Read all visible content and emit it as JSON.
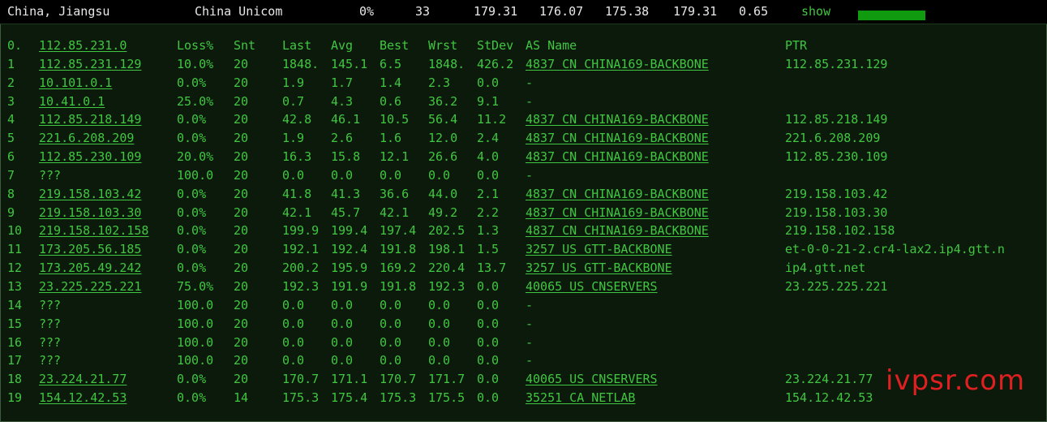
{
  "status": {
    "location": "China, Jiangsu",
    "isp": "China Unicom",
    "loss": "0%",
    "sent": "33",
    "last": "179.31",
    "avg": "176.07",
    "best": "175.38",
    "worst": "179.31",
    "stdev": "0.65",
    "show_label": "show",
    "progress": 1.0,
    "bar_color": "#0f9a0f"
  },
  "headers": {
    "hop": "0.",
    "host": "112.85.231.0",
    "loss": "Loss%",
    "snt": "Snt",
    "last": "Last",
    "avg": "Avg",
    "best": "Best",
    "wrst": "Wrst",
    "stdev": "StDev",
    "asname": "AS Name",
    "ptr": "PTR"
  },
  "hops": [
    {
      "hop": "1",
      "host": "112.85.231.129",
      "loss": "10.0%",
      "snt": "20",
      "last": "1848.",
      "avg": "145.1",
      "best": "6.5",
      "wrst": "1848.",
      "stdev": "426.2",
      "as": "4837  CN CHINA169-BACKBONE",
      "ptr": "112.85.231.129"
    },
    {
      "hop": "2",
      "host": "10.101.0.1",
      "loss": "0.0%",
      "snt": "20",
      "last": "1.9",
      "avg": "1.7",
      "best": "1.4",
      "wrst": "2.3",
      "stdev": "0.0",
      "as": "-",
      "ptr": ""
    },
    {
      "hop": "3",
      "host": "10.41.0.1",
      "loss": "25.0%",
      "snt": "20",
      "last": "0.7",
      "avg": "4.3",
      "best": "0.6",
      "wrst": "36.2",
      "stdev": "9.1",
      "as": "-",
      "ptr": ""
    },
    {
      "hop": "4",
      "host": "112.85.218.149",
      "loss": "0.0%",
      "snt": "20",
      "last": "42.8",
      "avg": "46.1",
      "best": "10.5",
      "wrst": "56.4",
      "stdev": "11.2",
      "as": "4837  CN CHINA169-BACKBONE",
      "ptr": "112.85.218.149"
    },
    {
      "hop": "5",
      "host": "221.6.208.209",
      "loss": "0.0%",
      "snt": "20",
      "last": "1.9",
      "avg": "2.6",
      "best": "1.6",
      "wrst": "12.0",
      "stdev": "2.4",
      "as": "4837  CN CHINA169-BACKBONE",
      "ptr": "221.6.208.209"
    },
    {
      "hop": "6",
      "host": "112.85.230.109",
      "loss": "20.0%",
      "snt": "20",
      "last": "16.3",
      "avg": "15.8",
      "best": "12.1",
      "wrst": "26.6",
      "stdev": "4.0",
      "as": "4837  CN CHINA169-BACKBONE",
      "ptr": "112.85.230.109"
    },
    {
      "hop": "7",
      "host": "???",
      "loss": "100.0",
      "snt": "20",
      "last": "0.0",
      "avg": "0.0",
      "best": "0.0",
      "wrst": "0.0",
      "stdev": "0.0",
      "as": "-",
      "ptr": ""
    },
    {
      "hop": "8",
      "host": "219.158.103.42",
      "loss": "0.0%",
      "snt": "20",
      "last": "41.8",
      "avg": "41.3",
      "best": "36.6",
      "wrst": "44.0",
      "stdev": "2.1",
      "as": "4837  CN CHINA169-BACKBONE",
      "ptr": "219.158.103.42"
    },
    {
      "hop": "9",
      "host": "219.158.103.30",
      "loss": "0.0%",
      "snt": "20",
      "last": "42.1",
      "avg": "45.7",
      "best": "42.1",
      "wrst": "49.2",
      "stdev": "2.2",
      "as": "4837  CN CHINA169-BACKBONE",
      "ptr": "219.158.103.30"
    },
    {
      "hop": "10",
      "host": "219.158.102.158",
      "loss": "0.0%",
      "snt": "20",
      "last": "199.9",
      "avg": "199.4",
      "best": "197.4",
      "wrst": "202.5",
      "stdev": "1.3",
      "as": "4837  CN CHINA169-BACKBONE",
      "ptr": "219.158.102.158"
    },
    {
      "hop": "11",
      "host": "173.205.56.185",
      "loss": "0.0%",
      "snt": "20",
      "last": "192.1",
      "avg": "192.4",
      "best": "191.8",
      "wrst": "198.1",
      "stdev": "1.5",
      "as": "3257  US GTT-BACKBONE",
      "ptr": "et-0-0-21-2.cr4-lax2.ip4.gtt.n"
    },
    {
      "hop": "12",
      "host": "173.205.49.242",
      "loss": "0.0%",
      "snt": "20",
      "last": "200.2",
      "avg": "195.9",
      "best": "169.2",
      "wrst": "220.4",
      "stdev": "13.7",
      "as": "3257  US GTT-BACKBONE",
      "ptr": "ip4.gtt.net"
    },
    {
      "hop": "13",
      "host": "23.225.225.221",
      "loss": "75.0%",
      "snt": "20",
      "last": "192.3",
      "avg": "191.9",
      "best": "191.8",
      "wrst": "192.3",
      "stdev": "0.0",
      "as": "40065 US CNSERVERS",
      "ptr": "23.225.225.221"
    },
    {
      "hop": "14",
      "host": "???",
      "loss": "100.0",
      "snt": "20",
      "last": "0.0",
      "avg": "0.0",
      "best": "0.0",
      "wrst": "0.0",
      "stdev": "0.0",
      "as": "-",
      "ptr": ""
    },
    {
      "hop": "15",
      "host": "???",
      "loss": "100.0",
      "snt": "20",
      "last": "0.0",
      "avg": "0.0",
      "best": "0.0",
      "wrst": "0.0",
      "stdev": "0.0",
      "as": "-",
      "ptr": ""
    },
    {
      "hop": "16",
      "host": "???",
      "loss": "100.0",
      "snt": "20",
      "last": "0.0",
      "avg": "0.0",
      "best": "0.0",
      "wrst": "0.0",
      "stdev": "0.0",
      "as": "-",
      "ptr": ""
    },
    {
      "hop": "17",
      "host": "???",
      "loss": "100.0",
      "snt": "20",
      "last": "0.0",
      "avg": "0.0",
      "best": "0.0",
      "wrst": "0.0",
      "stdev": "0.0",
      "as": "-",
      "ptr": ""
    },
    {
      "hop": "18",
      "host": "23.224.21.77",
      "loss": "0.0%",
      "snt": "20",
      "last": "170.7",
      "avg": "171.1",
      "best": "170.7",
      "wrst": "171.7",
      "stdev": "0.0",
      "as": "40065 US CNSERVERS",
      "ptr": "23.224.21.77"
    },
    {
      "hop": "19",
      "host": "154.12.42.53",
      "loss": "0.0%",
      "snt": "14",
      "last": "175.3",
      "avg": "175.4",
      "best": "175.3",
      "wrst": "175.5",
      "stdev": "0.0",
      "as": "35251 CA NETLAB",
      "ptr": "154.12.42.53"
    }
  ],
  "watermark": "ivpsr.com"
}
